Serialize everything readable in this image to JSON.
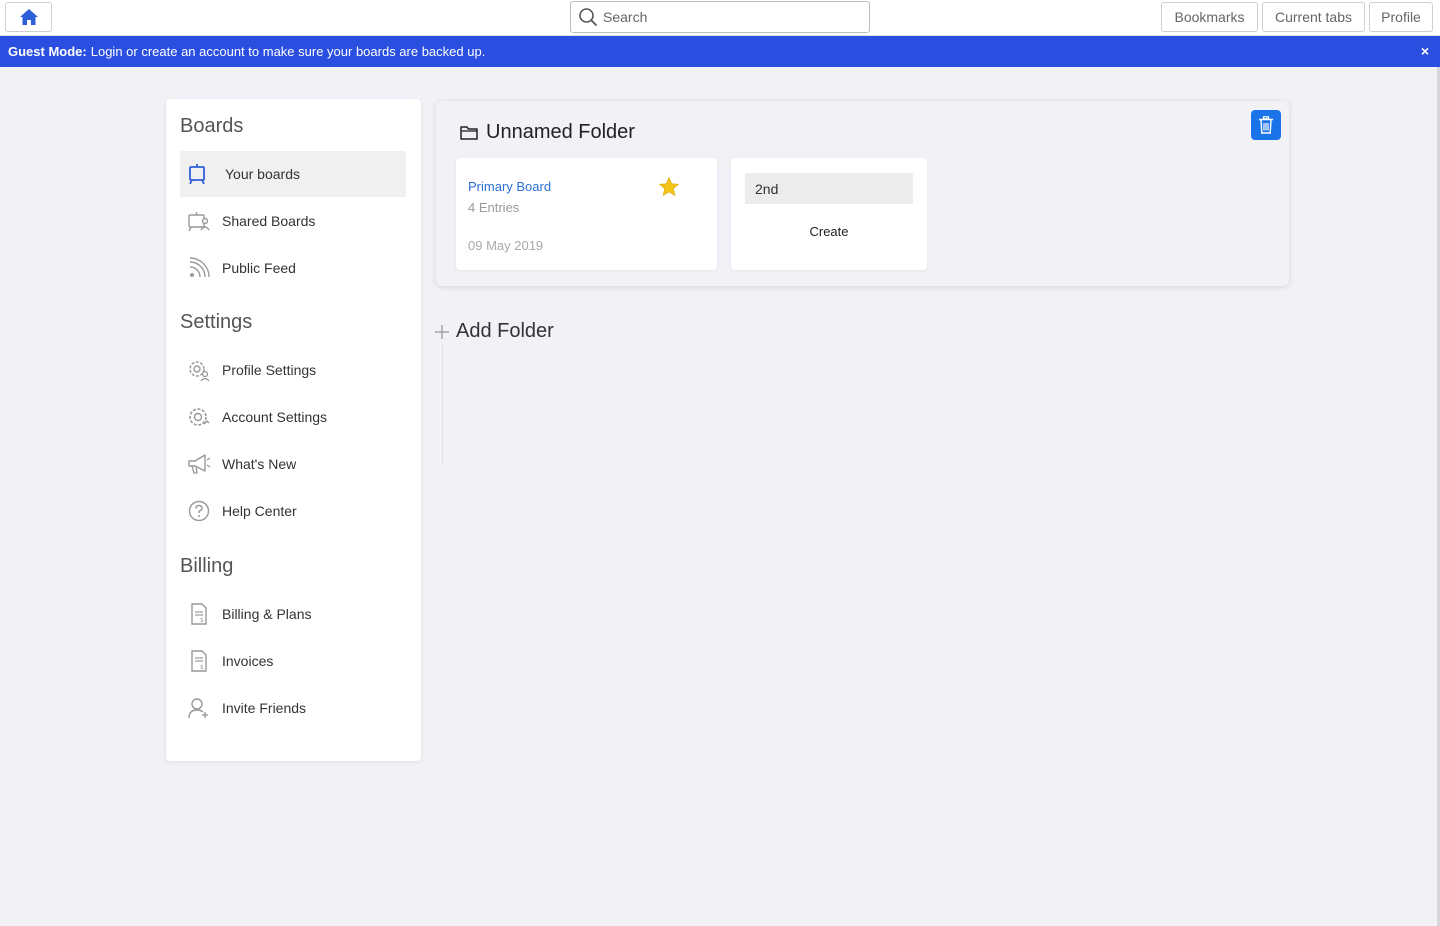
{
  "topbar": {
    "search_placeholder": "Search",
    "bookmarks_label": "Bookmarks",
    "current_tabs_label": "Current tabs",
    "profile_label": "Profile"
  },
  "banner": {
    "bold": "Guest Mode:",
    "message": "Login or create an account to make sure your boards are backed up.",
    "close": "×"
  },
  "sidebar": {
    "boards_heading": "Boards",
    "settings_heading": "Settings",
    "billing_heading": "Billing",
    "boards_items": [
      {
        "label": "Your boards",
        "icon": "board-icon"
      },
      {
        "label": "Shared Boards",
        "icon": "shared-board-icon"
      },
      {
        "label": "Public Feed",
        "icon": "rss-icon"
      }
    ],
    "settings_items": [
      {
        "label": "Profile Settings",
        "icon": "profile-gear-icon"
      },
      {
        "label": "Account Settings",
        "icon": "gear-icon"
      },
      {
        "label": "What's New",
        "icon": "megaphone-icon"
      },
      {
        "label": "Help Center",
        "icon": "help-icon"
      }
    ],
    "billing_items": [
      {
        "label": "Billing & Plans",
        "icon": "billing-icon"
      },
      {
        "label": "Invoices",
        "icon": "invoice-icon"
      },
      {
        "label": "Invite Friends",
        "icon": "add-user-icon"
      }
    ]
  },
  "folder": {
    "title": "Unnamed Folder",
    "board": {
      "name": "Primary Board",
      "entries": "4 Entries",
      "date": "09 May 2019",
      "starred": true
    },
    "new_board": {
      "value": "2nd",
      "create_label": "Create"
    }
  },
  "add_folder_label": "Add Folder",
  "colors": {
    "accent": "#1a73e8",
    "banner": "#2a4ee0",
    "link": "#2a6fd6",
    "star": "#f5c518"
  }
}
